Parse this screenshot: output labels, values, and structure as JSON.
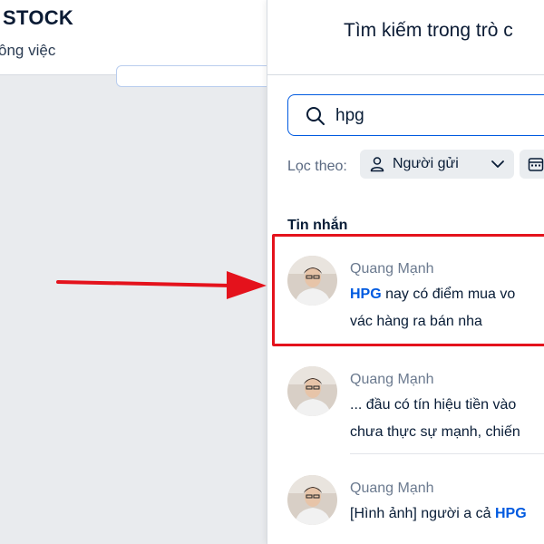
{
  "left": {
    "title": "STOCK",
    "subtitle": "ông việc"
  },
  "search_panel": {
    "title": "Tìm kiếm trong trò c",
    "query": "hpg",
    "filter_label": "Lọc theo:",
    "filter_sender_label": "Người gửi",
    "section_label": "Tin nhắn",
    "results": [
      {
        "sender": "Quang Mạnh",
        "line1_highlight": "HPG",
        "line1_rest": " nay có điểm mua vo",
        "line2": "vác hàng ra bán nha"
      },
      {
        "sender": "Quang Mạnh",
        "line1": "... đầu có tín hiệu tiền vào",
        "line2": "chưa thực sự mạnh, chiến"
      },
      {
        "sender": "Quang Mạnh",
        "line1_prefix": "[Hình ảnh] người a cả ",
        "line1_highlight": "HPG"
      }
    ]
  },
  "colors": {
    "accent": "#005ae0",
    "annotation": "#e4121c"
  }
}
